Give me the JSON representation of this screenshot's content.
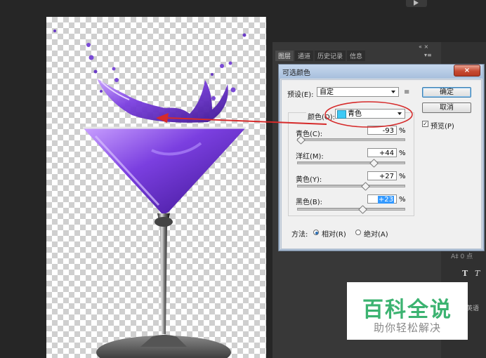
{
  "panel": {
    "tabs": [
      "图层",
      "通道",
      "历史记录",
      "信息"
    ],
    "controls": "«  ×",
    "menu": "▾≡"
  },
  "right_toolbar": {
    "pt_label": "A‡ 0 点",
    "lang_label": "英语"
  },
  "dialog": {
    "title": "可选颜色",
    "close_label": "×",
    "preset_label": "预设(E):",
    "preset_value": "自定",
    "ok_label": "确定",
    "cancel_label": "取消",
    "preview_label": "预览(P)",
    "preview_checked": true,
    "color_label": "颜色(O):",
    "color_value": "青色",
    "swatch_color": "#3ec9f5",
    "sliders": [
      {
        "label": "青色(C):",
        "value": "-93",
        "unit": "%",
        "numeric": -93,
        "selected": false
      },
      {
        "label": "洋红(M):",
        "value": "+44",
        "unit": "%",
        "numeric": 44,
        "selected": false
      },
      {
        "label": "黄色(Y):",
        "value": "+27",
        "unit": "%",
        "numeric": 27,
        "selected": false
      },
      {
        "label": "黑色(B):",
        "value": "+23",
        "unit": "%",
        "numeric": 23,
        "selected": true
      }
    ],
    "method_label": "方法:",
    "method_options": [
      {
        "label": "相对(R)",
        "selected": true
      },
      {
        "label": "绝对(A)",
        "selected": false
      }
    ]
  },
  "annotation": {
    "arrow_color": "#d62a2a"
  },
  "watermark": {
    "title": "百科全说",
    "subtitle": "助你轻松解决",
    "title_color": "#3cb371"
  }
}
